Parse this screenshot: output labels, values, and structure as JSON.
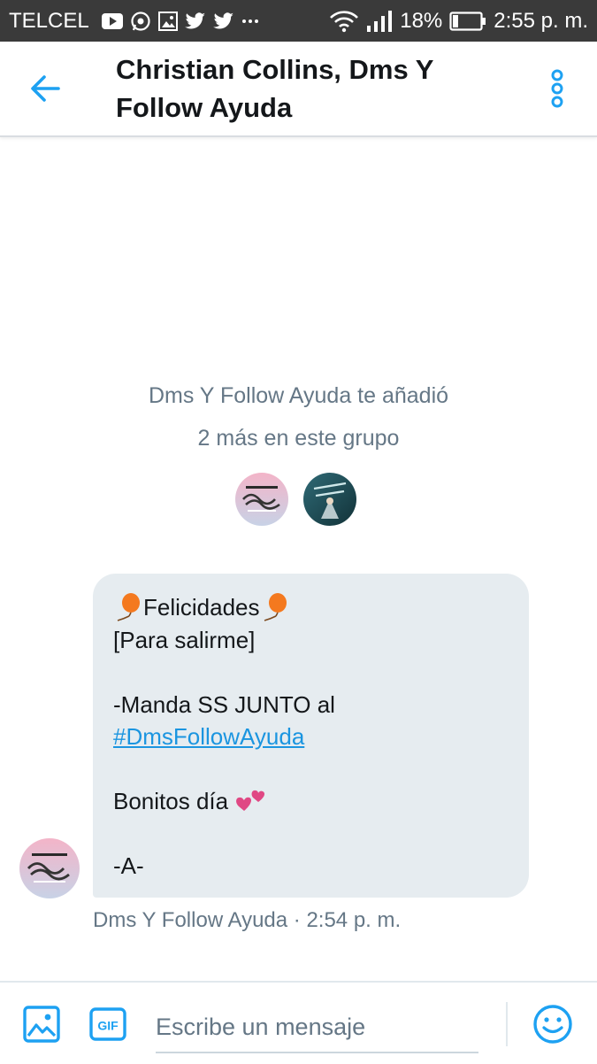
{
  "status_bar": {
    "carrier": "TELCEL",
    "battery": "18%",
    "time": "2:55 p. m.",
    "notification_icons": [
      "youtube-icon",
      "whatsapp-icon",
      "gallery-icon",
      "twitter-icon",
      "twitter-icon",
      "more-dots-icon"
    ]
  },
  "header": {
    "title": "Christian Collins, Dms Y Follow Ayuda",
    "back_icon": "arrow-left-icon",
    "more_icon": "more-vertical-icon"
  },
  "conversation": {
    "added_text": "Dms Y Follow Ayuda te añadió",
    "members_text": "2 más en este grupo"
  },
  "message": {
    "title": "Felicidades",
    "line2": "[Para salirme]",
    "line3": "-Manda SS JUNTO al",
    "hashtag": "#DmsFollowAyuda",
    "line5": "Bonitos día",
    "line6": "-A-",
    "meta": "Dms Y Follow Ayuda · 2:54 p. m."
  },
  "composer": {
    "placeholder": "Escribe un mensaje",
    "gif_label": "GIF"
  },
  "colors": {
    "accent": "#1da1f2",
    "bubble": "#e6ecf0",
    "muted": "#657786",
    "status_bar": "#3a3a3a"
  }
}
